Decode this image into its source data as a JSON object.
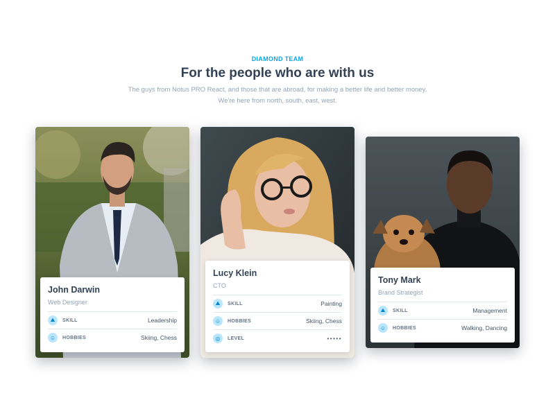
{
  "section": {
    "eyebrow": "DIAMOND TEAM",
    "title": "For the people who are with us",
    "description_line1": "The guys from Notus PRO React, and those that are abroad, for making a better life and better money.",
    "description_line2": "We're here from north, south, east, west."
  },
  "cards": [
    {
      "name": "John Darwin",
      "role": "Web Designer",
      "rows": [
        {
          "icon": "skill-icon",
          "label": "SKILL",
          "value": "Leadership"
        },
        {
          "icon": "user-icon",
          "label": "HOBBIES",
          "value": "Skiing, Chess"
        }
      ]
    },
    {
      "name": "Lucy Klein",
      "role": "CTO",
      "rows": [
        {
          "icon": "skill-icon",
          "label": "SKILL",
          "value": "Painting"
        },
        {
          "icon": "user-icon",
          "label": "HOBBIES",
          "value": "Skiing, Chess"
        },
        {
          "icon": "level-icon",
          "label": "LEVEL",
          "value": "•••••"
        }
      ]
    },
    {
      "name": "Tony Mark",
      "role": "Brand Strategist",
      "rows": [
        {
          "icon": "skill-icon",
          "label": "SKILL",
          "value": "Management"
        },
        {
          "icon": "user-icon",
          "label": "HOBBIES",
          "value": "Walking, Dancing"
        }
      ]
    }
  ],
  "colors": {
    "accent": "#0ea5e9",
    "heading": "#334155",
    "muted": "#94a3b8",
    "icon_bg": "#bae6fd"
  }
}
